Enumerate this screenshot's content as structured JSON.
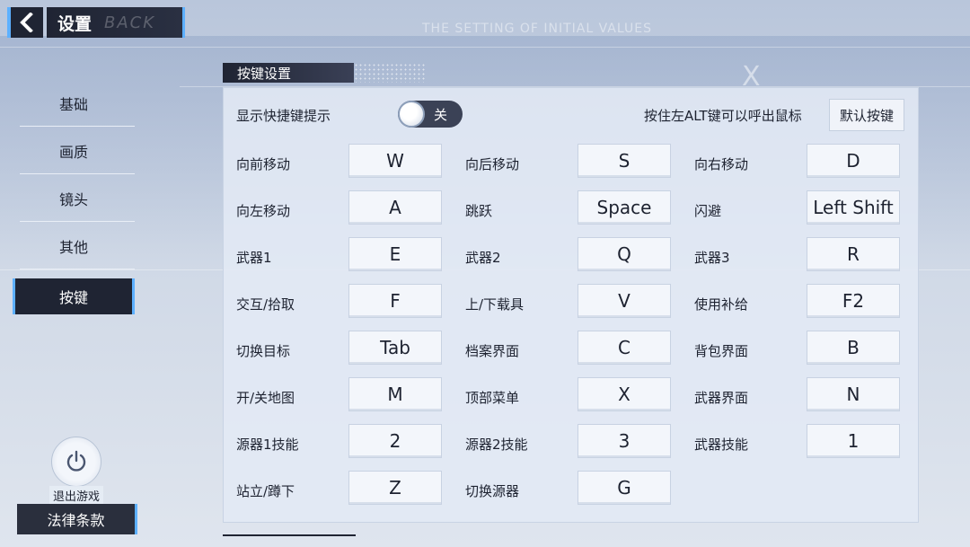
{
  "header": {
    "title": "设置",
    "watermark": "BACK"
  },
  "background": {
    "heading": "THE SETTING OF INITIAL VALUES"
  },
  "nav": {
    "items": [
      {
        "label": "基础",
        "active": false
      },
      {
        "label": "画质",
        "active": false
      },
      {
        "label": "镜头",
        "active": false
      },
      {
        "label": "其他",
        "active": false
      },
      {
        "label": "按键",
        "active": true
      }
    ]
  },
  "exit": {
    "label": "退出游戏",
    "icon": "power-icon"
  },
  "legal": {
    "label": "法律条款"
  },
  "panel": {
    "title": "按键设置",
    "hint_label": "显示快捷键提示",
    "toggle_state": "关",
    "alt_hint": "按住左ALT键可以呼出鼠标",
    "default_button": "默认按键",
    "rows": [
      [
        {
          "action": "向前移动",
          "key": "W"
        },
        {
          "action": "向后移动",
          "key": "S"
        },
        {
          "action": "向右移动",
          "key": "D"
        }
      ],
      [
        {
          "action": "向左移动",
          "key": "A"
        },
        {
          "action": "跳跃",
          "key": "Space"
        },
        {
          "action": "闪避",
          "key": "Left Shift"
        }
      ],
      [
        {
          "action": "武器1",
          "key": "E"
        },
        {
          "action": "武器2",
          "key": "Q"
        },
        {
          "action": "武器3",
          "key": "R"
        }
      ],
      [
        {
          "action": "交互/拾取",
          "key": "F"
        },
        {
          "action": "上/下载具",
          "key": "V"
        },
        {
          "action": "使用补给",
          "key": "F2"
        }
      ],
      [
        {
          "action": "切换目标",
          "key": "Tab"
        },
        {
          "action": "档案界面",
          "key": "C"
        },
        {
          "action": "背包界面",
          "key": "B"
        }
      ],
      [
        {
          "action": "开/关地图",
          "key": "M"
        },
        {
          "action": "顶部菜单",
          "key": "X"
        },
        {
          "action": "武器界面",
          "key": "N"
        }
      ],
      [
        {
          "action": "源器1技能",
          "key": "2"
        },
        {
          "action": "源器2技能",
          "key": "3"
        },
        {
          "action": "武器技能",
          "key": "1"
        }
      ],
      [
        {
          "action": "站立/蹲下",
          "key": "Z"
        },
        {
          "action": "切换源器",
          "key": "G"
        }
      ]
    ]
  },
  "colors": {
    "accent": "#5db0ff",
    "dark": "#1f2433",
    "panel_bg": "#e2e9f5"
  }
}
